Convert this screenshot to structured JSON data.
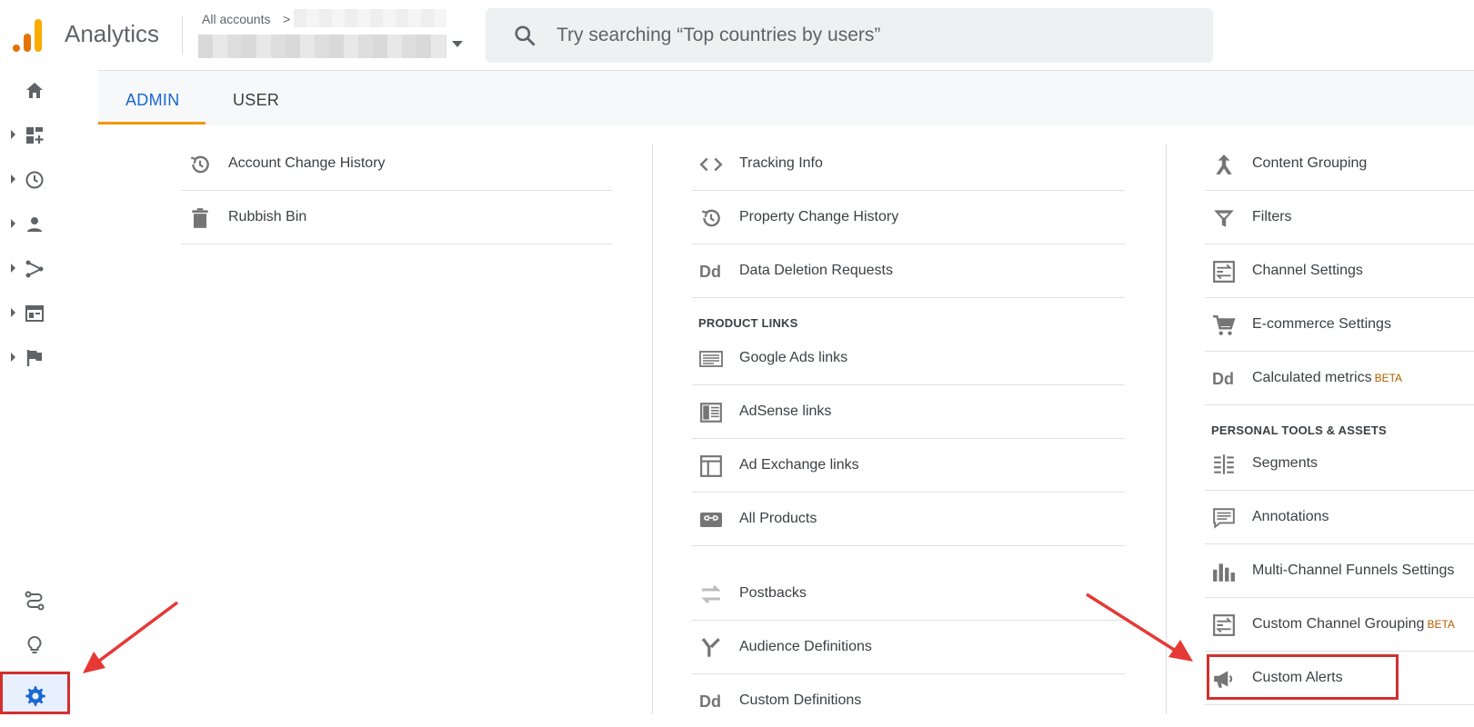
{
  "header": {
    "product_name": "Analytics",
    "account_label": "All accounts",
    "account_chevron": ">",
    "search_placeholder": "Try searching “Top countries by users”"
  },
  "colors": {
    "accent_blue": "#1967d2",
    "tab_underline": "#f29900",
    "highlight_red": "#d32f2f",
    "logo_orange": "#f9ab00",
    "logo_dark_orange": "#e37400"
  },
  "rail": {
    "items": [
      {
        "icon": "home-icon"
      },
      {
        "icon": "customization-icon"
      },
      {
        "icon": "realtime-clock-icon"
      },
      {
        "icon": "audience-person-icon"
      },
      {
        "icon": "acquisition-icon"
      },
      {
        "icon": "behavior-icon"
      },
      {
        "icon": "conversions-flag-icon"
      }
    ],
    "bottom": [
      {
        "icon": "attribution-icon"
      },
      {
        "icon": "discover-lightbulb-icon"
      },
      {
        "icon": "admin-gear-icon"
      }
    ]
  },
  "tabs": [
    {
      "label": "ADMIN",
      "active": true
    },
    {
      "label": "USER",
      "active": false
    }
  ],
  "account_column": {
    "items": [
      {
        "label": "Account Change History",
        "icon": "history-icon"
      },
      {
        "label": "Rubbish Bin",
        "icon": "trash-icon"
      }
    ]
  },
  "property_column": {
    "items": [
      {
        "label": "Tracking Info",
        "icon": "code-icon"
      },
      {
        "label": "Property Change History",
        "icon": "history-icon"
      },
      {
        "label": "Data Deletion Requests",
        "icon": "dd-icon"
      }
    ],
    "section_product_links": "PRODUCT LINKS",
    "product_links": [
      {
        "label": "Google Ads links",
        "icon": "google-ads-icon"
      },
      {
        "label": "AdSense links",
        "icon": "adsense-icon"
      },
      {
        "label": "Ad Exchange links",
        "icon": "ad-exchange-icon"
      },
      {
        "label": "All Products",
        "icon": "all-products-icon"
      }
    ],
    "more": [
      {
        "label": "Postbacks",
        "icon": "postbacks-icon"
      },
      {
        "label": "Audience Definitions",
        "icon": "audience-definitions-icon"
      },
      {
        "label": "Custom Definitions",
        "icon": "dd-icon"
      }
    ]
  },
  "view_column": {
    "items": [
      {
        "label": "Content Grouping",
        "icon": "content-grouping-icon"
      },
      {
        "label": "Filters",
        "icon": "filter-icon"
      },
      {
        "label": "Channel Settings",
        "icon": "channel-settings-icon"
      },
      {
        "label": "E-commerce Settings",
        "icon": "cart-icon"
      },
      {
        "label": "Calculated metrics",
        "beta": "BETA",
        "icon": "dd-icon"
      }
    ],
    "section_personal": "PERSONAL TOOLS & ASSETS",
    "personal": [
      {
        "label": "Segments",
        "icon": "segments-icon"
      },
      {
        "label": "Annotations",
        "icon": "annotations-icon"
      },
      {
        "label": "Multi-Channel Funnels Settings",
        "icon": "bar-chart-icon"
      },
      {
        "label": "Custom Channel Grouping",
        "beta": "BETA",
        "icon": "channel-settings-icon"
      },
      {
        "label": "Custom Alerts",
        "icon": "megaphone-icon"
      }
    ]
  }
}
